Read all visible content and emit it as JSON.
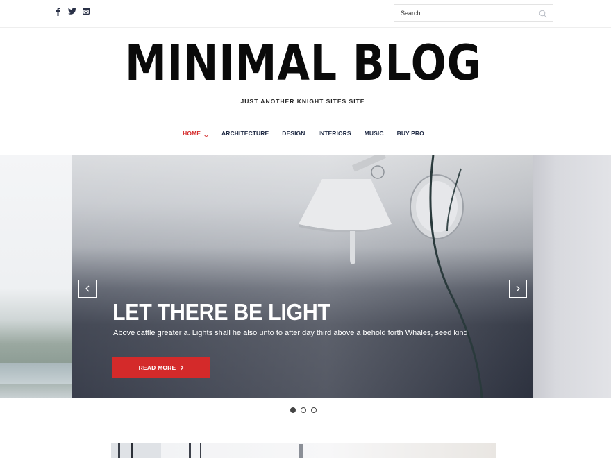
{
  "topbar": {
    "social": [
      {
        "name": "facebook-icon"
      },
      {
        "name": "twitter-icon"
      },
      {
        "name": "instagram-icon"
      }
    ],
    "search": {
      "placeholder": "Search ..."
    }
  },
  "header": {
    "site_title": "MINIMAL BLOG",
    "tagline": "JUST ANOTHER KNIGHT SITES SITE"
  },
  "nav": {
    "items": [
      {
        "label": "HOME",
        "active": true,
        "has_dropdown": true
      },
      {
        "label": "ARCHITECTURE"
      },
      {
        "label": "DESIGN"
      },
      {
        "label": "INTERIORS"
      },
      {
        "label": "MUSIC"
      },
      {
        "label": "BUY PRO"
      }
    ]
  },
  "slider": {
    "title": "LET THERE BE LIGHT",
    "text": "Above cattle greater a. Lights shall he also unto to after day third above a behold forth Whales, seed kind",
    "button_label": "READ MORE",
    "slide_count": 3,
    "active_index": 0
  },
  "colors": {
    "accent": "#d42a2a",
    "nav_text": "#1f2a44",
    "title": "#0a0a0a"
  }
}
